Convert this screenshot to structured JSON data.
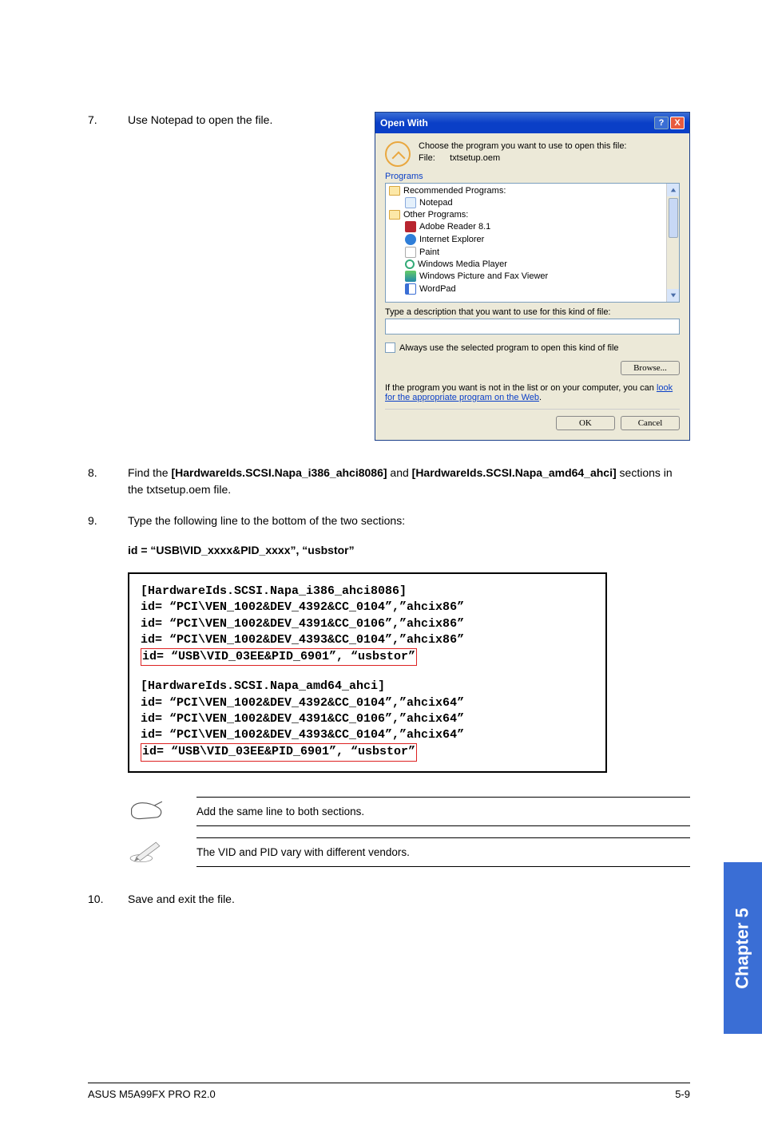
{
  "steps": {
    "s7": {
      "num": "7.",
      "text": "Use Notepad to open the file."
    },
    "s8": {
      "num": "8.",
      "text_prefix": "Find the ",
      "bold1": "[HardwareIds.SCSI.Napa_i386_ahci8086]",
      "mid": " and ",
      "bold2": "[HardwareIds.SCSI.Napa_amd64_ahci]",
      "text_suffix": " sections in the txtsetup.oem file."
    },
    "s9": {
      "num": "9.",
      "text": "Type the following line to the bottom of the two sections:"
    },
    "s10": {
      "num": "10.",
      "text": "Save and exit the file."
    }
  },
  "idline": "id = “USB\\VID_xxxx&PID_xxxx”, “usbstor”",
  "dialog": {
    "title": "Open With",
    "help_btn": "?",
    "close_btn": "X",
    "choose_text": "Choose the program you want to use to open this file:",
    "file_label": "File:",
    "file_name": "txtsetup.oem",
    "programs_label": "Programs",
    "recommended": "Recommended Programs:",
    "notepad": "Notepad",
    "other": "Other Programs:",
    "adobe": "Adobe Reader 8.1",
    "ie": "Internet Explorer",
    "paint": "Paint",
    "wmp": "Windows Media Player",
    "picview": "Windows Picture and Fax Viewer",
    "wordpad": "WordPad",
    "type_desc": "Type a description that you want to use for this kind of file:",
    "always_use": "Always use the selected program to open this kind of file",
    "browse": "Browse...",
    "link_text_1": "If the program you want is not in the list or on your computer, you can ",
    "link_look": "look for the appropriate program on the Web",
    "ok": "OK",
    "cancel": "Cancel"
  },
  "code": {
    "h1": "[HardwareIds.SCSI.Napa_i386_ahci8086]",
    "l1": "id= “PCI\\VEN_1002&DEV_4392&CC_0104”,”ahcix86”",
    "l2": "id= “PCI\\VEN_1002&DEV_4391&CC_0106”,”ahcix86”",
    "l3": "id= “PCI\\VEN_1002&DEV_4393&CC_0104”,”ahcix86”",
    "l4": "id= “USB\\VID_03EE&PID_6901”, “usbstor”",
    "h2": "[HardwareIds.SCSI.Napa_amd64_ahci]",
    "l5": "id= “PCI\\VEN_1002&DEV_4392&CC_0104”,”ahcix64”",
    "l6": "id= “PCI\\VEN_1002&DEV_4391&CC_0106”,”ahcix64”",
    "l7": "id= “PCI\\VEN_1002&DEV_4393&CC_0104”,”ahcix64”",
    "l8": "id= “USB\\VID_03EE&PID_6901”, “usbstor”"
  },
  "notes": {
    "n1": "Add the same line to both sections.",
    "n2": "The VID and PID vary with different vendors."
  },
  "sidetab": "Chapter 5",
  "footer": {
    "left": "ASUS M5A99FX PRO R2.0",
    "right": "5-9"
  }
}
